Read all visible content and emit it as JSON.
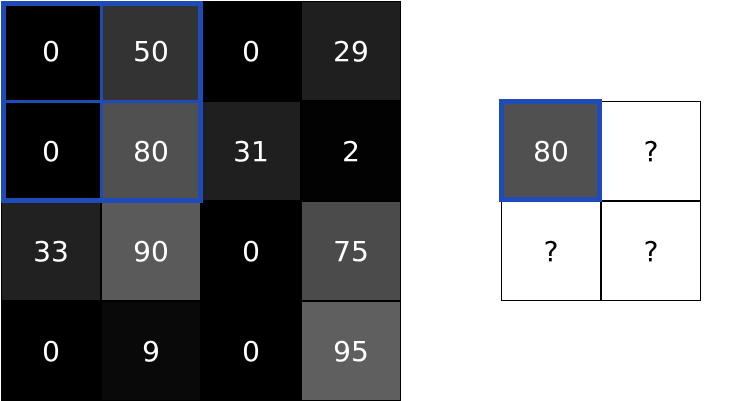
{
  "input_matrix": {
    "values": [
      [
        "0",
        "50",
        "0",
        "29"
      ],
      [
        "0",
        "80",
        "31",
        "2"
      ],
      [
        "33",
        "90",
        "0",
        "75"
      ],
      [
        "0",
        "9",
        "0",
        "95"
      ]
    ],
    "colors": [
      [
        "#000000",
        "#333333",
        "#000000",
        "#1f1f1f"
      ],
      [
        "#000000",
        "#505050",
        "#1f1f1f",
        "#020202"
      ],
      [
        "#212121",
        "#5a5a5a",
        "#000000",
        "#4b4b4b"
      ],
      [
        "#000000",
        "#090909",
        "#000000",
        "#5f5f5f"
      ]
    ]
  },
  "output_matrix": {
    "values": [
      [
        "80",
        "?"
      ],
      [
        "?",
        "?"
      ]
    ],
    "colors": [
      [
        "#505050",
        "#ffffff"
      ],
      [
        "#ffffff",
        "#ffffff"
      ]
    ],
    "text_colors": [
      [
        "#ffffff",
        "#000000"
      ],
      [
        "#000000",
        "#000000"
      ]
    ]
  },
  "highlight_color": "#1f4bb8"
}
